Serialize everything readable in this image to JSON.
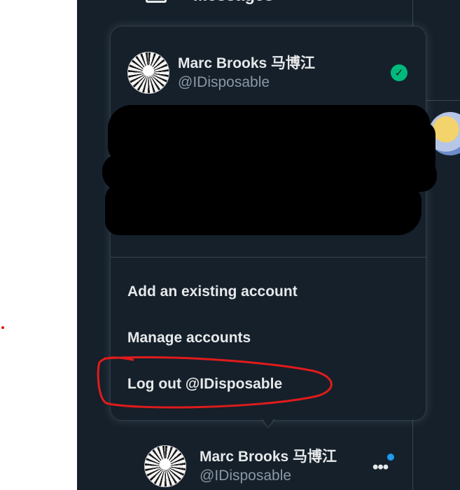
{
  "top_nav": {
    "label": "Messages",
    "icon": "envelope-icon"
  },
  "account_menu": {
    "current_account": {
      "name": "Marc Brooks 马博江",
      "handle": "@IDisposable",
      "selected_indicator": "check-icon"
    },
    "items": [
      {
        "label": "Add an existing account"
      },
      {
        "label": "Manage accounts"
      },
      {
        "label": "Log out @IDisposable"
      }
    ]
  },
  "bottom_account": {
    "name": "Marc Brooks 马博江",
    "handle": "@IDisposable",
    "more_icon": "more-horizontal-icon",
    "notification_color": "#1d9bf0"
  },
  "colors": {
    "background": "#15202b",
    "text_primary": "#e7e9ea",
    "text_secondary": "#8b98a5",
    "verified_check": "#00ba7c",
    "annotation": "#e01b1b"
  }
}
